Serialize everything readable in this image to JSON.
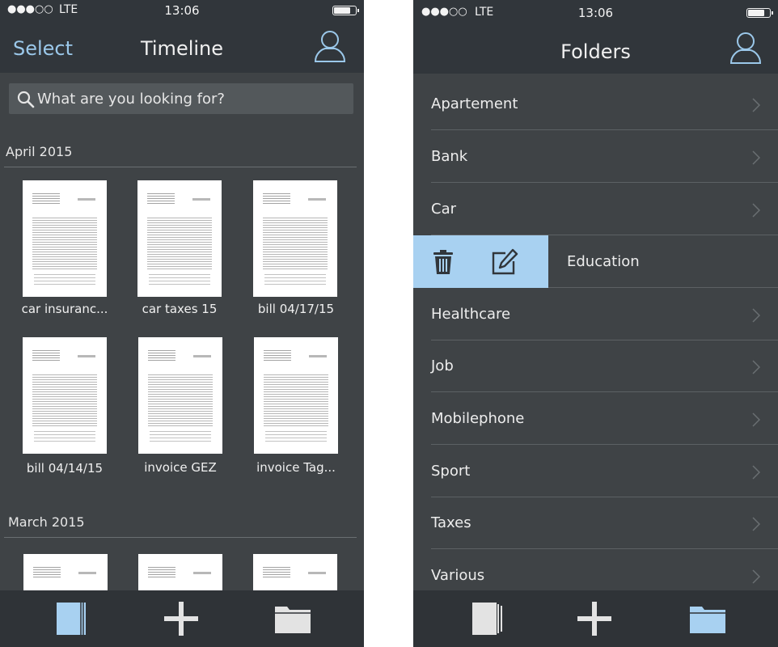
{
  "left_screen": {
    "status": {
      "signal": "●●●○○",
      "carrier": "LTE",
      "time": "13:06"
    },
    "nav": {
      "select_label": "Select",
      "title": "Timeline"
    },
    "search": {
      "placeholder": "What are you looking for?"
    },
    "sections": [
      {
        "label": "April 2015",
        "documents": [
          {
            "caption": "car insuranc..."
          },
          {
            "caption": "car taxes 15"
          },
          {
            "caption": "bill 04/17/15"
          },
          {
            "caption": "bill 04/14/15"
          },
          {
            "caption": "invoice GEZ"
          },
          {
            "caption": "invoice Tag..."
          }
        ]
      },
      {
        "label": "March 2015",
        "documents": []
      }
    ],
    "tabs": [
      "documents-icon",
      "add-icon",
      "folder-icon"
    ],
    "active_tab": "documents"
  },
  "right_screen": {
    "status": {
      "signal": "●●●○○",
      "carrier": "LTE",
      "time": "13:06"
    },
    "nav": {
      "title": "Folders"
    },
    "folders": [
      {
        "label": "Apartement"
      },
      {
        "label": "Bank"
      },
      {
        "label": "Car"
      },
      {
        "label": "Education"
      },
      {
        "label": "Healthcare"
      },
      {
        "label": "Job"
      },
      {
        "label": "Mobilephone"
      },
      {
        "label": "Sport"
      },
      {
        "label": "Taxes"
      },
      {
        "label": "Various"
      }
    ],
    "swipe_actions": [
      "trash-icon",
      "edit-icon"
    ],
    "tabs": [
      "documents-icon",
      "add-icon",
      "folder-icon"
    ],
    "active_tab": "folders"
  },
  "colors": {
    "accent": "#a8d1f1",
    "select_text": "#9bc8ea",
    "topbar": "#31363b",
    "background": "#3f4346",
    "bottombar": "#2f3337"
  }
}
